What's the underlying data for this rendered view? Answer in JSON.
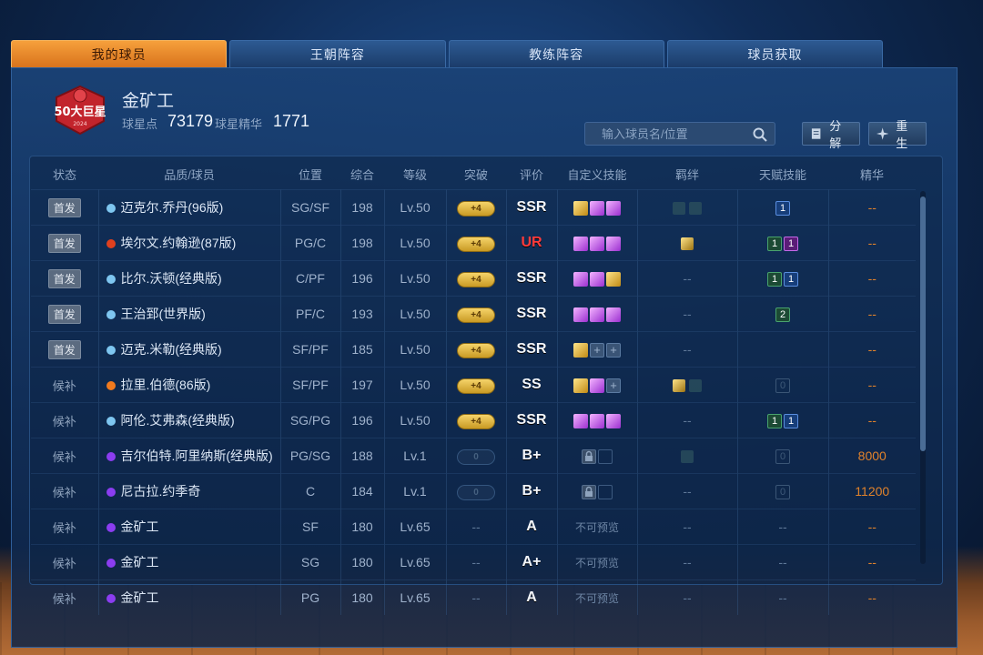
{
  "tabs": [
    "我的球员",
    "王朝阵容",
    "教练阵容",
    "球员获取"
  ],
  "header": {
    "title": "金矿工",
    "star_points_label": "球星点",
    "star_points": "73179",
    "essence_label": "球星精华",
    "essence": "1771",
    "search_placeholder": "输入球员名/位置",
    "decompose_label": "分解",
    "rebirth_label": "重生"
  },
  "columns": [
    "状态",
    "品质/球员",
    "位置",
    "综合",
    "等级",
    "突破",
    "评价",
    "自定义技能",
    "羁绊",
    "天赋技能",
    "精华"
  ],
  "rows": [
    {
      "status": "首发",
      "quality": "blue",
      "name": "迈克尔.乔丹(96版)",
      "pos": "SG/SF",
      "ovr": "198",
      "lv": "Lv.50",
      "brk": "+4",
      "rating": "SSR",
      "skills": [
        "gold",
        "purple",
        "purple"
      ],
      "bonds": [
        "dim",
        "dim"
      ],
      "talents": [
        {
          "c": "blue",
          "v": "1"
        }
      ],
      "ess": "--"
    },
    {
      "status": "首发",
      "quality": "red",
      "name": "埃尔文.约翰逊(87版)",
      "pos": "PG/C",
      "ovr": "198",
      "lv": "Lv.50",
      "brk": "+4",
      "rating": "UR",
      "skills": [
        "purple",
        "purple",
        "purple"
      ],
      "bonds": [
        "gold"
      ],
      "talents": [
        {
          "c": "green",
          "v": "1"
        },
        {
          "c": "purple",
          "v": "1"
        }
      ],
      "ess": "--"
    },
    {
      "status": "首发",
      "quality": "blue",
      "name": "比尔.沃顿(经典版)",
      "pos": "C/PF",
      "ovr": "196",
      "lv": "Lv.50",
      "brk": "+4",
      "rating": "SSR",
      "skills": [
        "purple",
        "purple",
        "gold"
      ],
      "bonds_text": "--",
      "talents": [
        {
          "c": "green",
          "v": "1"
        },
        {
          "c": "blue",
          "v": "1"
        }
      ],
      "ess": "--"
    },
    {
      "status": "首发",
      "quality": "blue",
      "name": "王治郅(世界版)",
      "pos": "PF/C",
      "ovr": "193",
      "lv": "Lv.50",
      "brk": "+4",
      "rating": "SSR",
      "skills": [
        "purple",
        "purple",
        "purple"
      ],
      "bonds_text": "--",
      "talents": [
        {
          "c": "green",
          "v": "2"
        }
      ],
      "ess": "--"
    },
    {
      "status": "首发",
      "quality": "blue",
      "name": "迈克.米勒(经典版)",
      "pos": "SF/PF",
      "ovr": "185",
      "lv": "Lv.50",
      "brk": "+4",
      "rating": "SSR",
      "skills": [
        "gold",
        "plus",
        "plus"
      ],
      "bonds_text": "--",
      "talents": [],
      "ess": "--"
    },
    {
      "status": "候补",
      "quality": "orange",
      "name": "拉里.伯德(86版)",
      "pos": "SF/PF",
      "ovr": "197",
      "lv": "Lv.50",
      "brk": "+4",
      "rating": "SS",
      "skills": [
        "gold",
        "purple",
        "plus"
      ],
      "bonds": [
        "gold",
        "dim"
      ],
      "talents": [
        {
          "c": "grey",
          "v": "0"
        }
      ],
      "ess": "--"
    },
    {
      "status": "候补",
      "quality": "blue",
      "name": "阿伦.艾弗森(经典版)",
      "pos": "SG/PG",
      "ovr": "196",
      "lv": "Lv.50",
      "brk": "+4",
      "rating": "SSR",
      "skills": [
        "purple",
        "purple",
        "purple"
      ],
      "bonds_text": "--",
      "talents": [
        {
          "c": "green",
          "v": "1"
        },
        {
          "c": "blue",
          "v": "1"
        }
      ],
      "ess": "--"
    },
    {
      "status": "候补",
      "quality": "purple",
      "name": "吉尔伯特.阿里纳斯(经典版)",
      "pos": "PG/SG",
      "ovr": "188",
      "lv": "Lv.1",
      "brk": "0",
      "rating": "B+",
      "skills": [
        "lock",
        "empty"
      ],
      "bonds": [
        "dim"
      ],
      "talents": [
        {
          "c": "grey",
          "v": "0"
        }
      ],
      "ess": "8000"
    },
    {
      "status": "候补",
      "quality": "purple",
      "name": "尼古拉.约季奇",
      "pos": "C",
      "ovr": "184",
      "lv": "Lv.1",
      "brk": "0",
      "rating": "B+",
      "skills": [
        "lock",
        "empty"
      ],
      "bonds_text": "--",
      "talents": [
        {
          "c": "grey",
          "v": "0"
        }
      ],
      "ess": "11200"
    },
    {
      "status": "候补",
      "quality": "purple",
      "name": "金矿工",
      "pos": "SF",
      "ovr": "180",
      "lv": "Lv.65",
      "brk": "--",
      "rating": "A",
      "skills_text": "不可预览",
      "bonds_text": "--",
      "talents_text": "--",
      "ess": "--"
    },
    {
      "status": "候补",
      "quality": "purple",
      "name": "金矿工",
      "pos": "SG",
      "ovr": "180",
      "lv": "Lv.65",
      "brk": "--",
      "rating": "A+",
      "skills_text": "不可预览",
      "bonds_text": "--",
      "talents_text": "--",
      "ess": "--"
    },
    {
      "status": "候补",
      "quality": "purple",
      "name": "金矿工",
      "pos": "PG",
      "ovr": "180",
      "lv": "Lv.65",
      "brk": "--",
      "rating": "A",
      "skills_text": "不可预览",
      "bonds_text": "--",
      "talents_text": "--",
      "ess": "--"
    }
  ],
  "colors": {
    "quality_blue": "#7ec6f0",
    "quality_red": "#e0401e",
    "quality_orange": "#f07a1e",
    "quality_purple": "#8b3df0",
    "essence": "#e0822b",
    "accent_tab": "#f0902e"
  },
  "logo_text": "50大巨星 2024"
}
